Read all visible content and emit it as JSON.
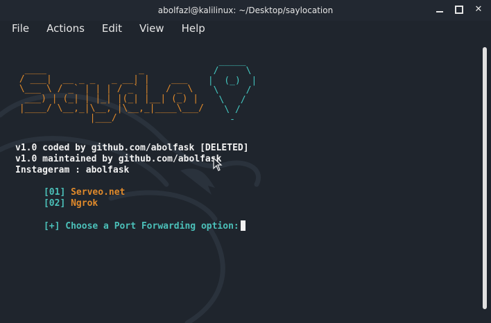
{
  "window": {
    "title": "abolfazl@kalilinux: ~/Desktop/saylocation",
    "controls": [
      "minimize-icon",
      "maximize-icon",
      "close-icon"
    ]
  },
  "menu": {
    "items": [
      "File",
      "Actions",
      "Edit",
      "View",
      "Help"
    ]
  },
  "terminal": {
    "ascii_title": "SayLo",
    "lines": {
      "coded_by": "v1.0 coded by github.com/abolfask [DELETED]",
      "maintained_by": "v1.0 maintained by github.com/abolfask",
      "instagram": "Instageram : abolfask"
    },
    "options": [
      {
        "num": "[01]",
        "label": "Serveo.net"
      },
      {
        "num": "[02]",
        "label": "Ngrok"
      }
    ],
    "prompt": "[+] Choose a Port Forwarding option:"
  },
  "colors": {
    "background": "#1f252d",
    "orange": "#e08a2b",
    "cyan": "#4bc0b9",
    "text": "#f2f2f2"
  }
}
